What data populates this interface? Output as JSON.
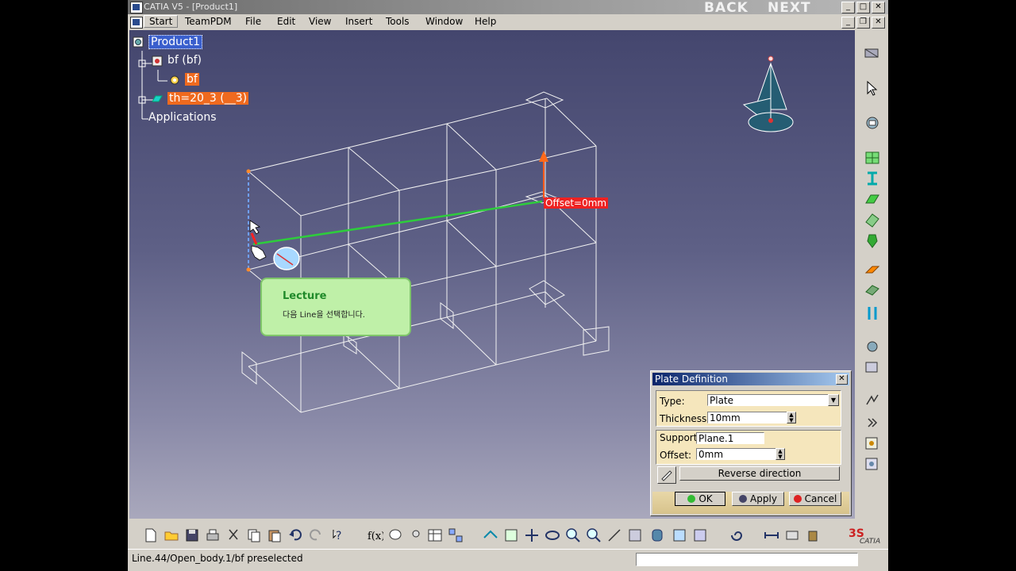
{
  "window": {
    "title": "CATIA V5 - [Product1]",
    "back_label": "BACK",
    "next_label": "NEXT"
  },
  "menu": {
    "items": [
      "Start",
      "TeamPDM",
      "File",
      "Edit",
      "View",
      "Insert",
      "Tools",
      "Window",
      "Help"
    ]
  },
  "tree": {
    "root": "Product1",
    "child": "bf (bf)",
    "subchild": "bf",
    "plane": "th=20_3 (__3)",
    "apps": "Applications"
  },
  "viewport": {
    "offset_label": "Offset=0mm"
  },
  "lecture": {
    "title": "Lecture",
    "body": "다음 Line을 선택합니다."
  },
  "dialog": {
    "title": "Plate Definition",
    "type_label": "Type:",
    "type_value": "Plate",
    "thickness_label": "Thickness:",
    "thickness_value": "10mm",
    "support_label": "Support:",
    "support_value": "Plane.1",
    "offset_label": "Offset:",
    "offset_value": "0mm",
    "reverse_label": "Reverse direction",
    "ok_label": "OK",
    "apply_label": "Apply",
    "cancel_label": "Cancel"
  },
  "status": {
    "text": "Line.44/Open_body.1/bf preselected"
  },
  "brand": {
    "catia": "CATIA"
  },
  "colors": {
    "accent_orange": "#ef6a1f",
    "selection_blue": "#3a5fcd",
    "offset_red": "#e22222",
    "line_green": "#2ecc3c"
  }
}
